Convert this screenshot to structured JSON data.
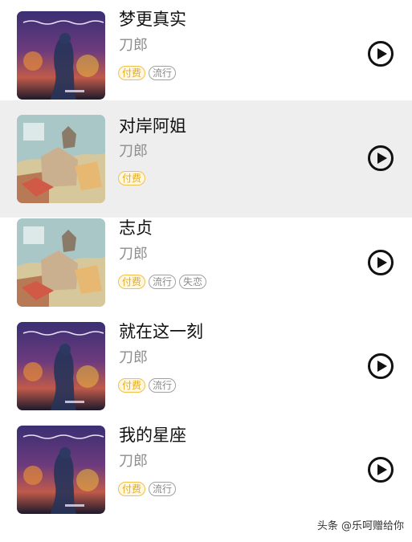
{
  "songs": [
    {
      "title": "梦更真实",
      "artist": "刀郎",
      "tags": [
        {
          "label": "付费",
          "kind": "paid"
        },
        {
          "label": "流行",
          "kind": "genre"
        }
      ],
      "cover": "album-cover-night",
      "highlighted": false
    },
    {
      "title": "对岸阿姐",
      "artist": "刀郎",
      "tags": [
        {
          "label": "付费",
          "kind": "paid"
        }
      ],
      "cover": "album-cover-town",
      "highlighted": true
    },
    {
      "title": "志贞",
      "artist": "刀郎",
      "tags": [
        {
          "label": "付费",
          "kind": "paid"
        },
        {
          "label": "流行",
          "kind": "genre"
        },
        {
          "label": "失恋",
          "kind": "genre"
        }
      ],
      "cover": "album-cover-town",
      "highlighted": false
    },
    {
      "title": "就在这一刻",
      "artist": "刀郎",
      "tags": [
        {
          "label": "付费",
          "kind": "paid"
        },
        {
          "label": "流行",
          "kind": "genre"
        }
      ],
      "cover": "album-cover-night",
      "highlighted": false
    },
    {
      "title": "我的星座",
      "artist": "刀郎",
      "tags": [
        {
          "label": "付费",
          "kind": "paid"
        },
        {
          "label": "流行",
          "kind": "genre"
        }
      ],
      "cover": "album-cover-night",
      "highlighted": false
    }
  ],
  "play_icon": "play-circle-icon",
  "watermark": "头条 @乐呵赠给你",
  "colors": {
    "paid_tag_text": "#e7ac1e",
    "paid_tag_border": "#f0c14b",
    "genre_tag_border": "#a0a0a0",
    "row_highlight": "#eeeeee"
  }
}
